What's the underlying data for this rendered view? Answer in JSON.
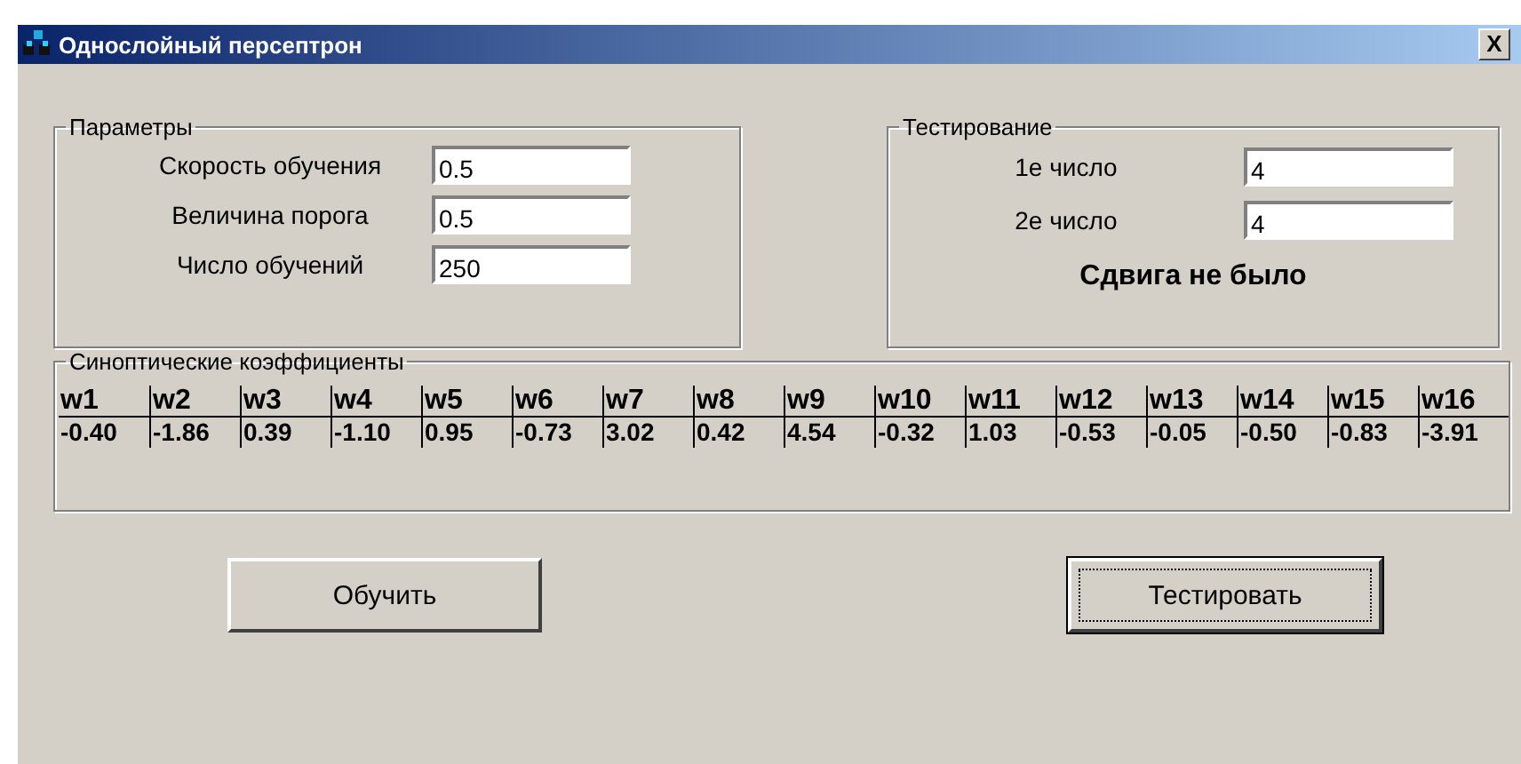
{
  "window": {
    "title": "Однослойный персептрон",
    "close": "X"
  },
  "parameters": {
    "title": "Параметры",
    "fields": [
      {
        "label": "Скорость обучения",
        "value": "0.5"
      },
      {
        "label": "Величина порога",
        "value": "0.5"
      },
      {
        "label": "Число обучений",
        "value": "250"
      }
    ]
  },
  "testing": {
    "title": "Тестирование",
    "fields": [
      {
        "label": "1е число",
        "value": "4"
      },
      {
        "label": "2е число",
        "value": "4"
      }
    ],
    "result": "Сдвига не было"
  },
  "weights": {
    "title": "Синоптические коэффициенты",
    "columns": [
      "w1",
      "w2",
      "w3",
      "w4",
      "w5",
      "w6",
      "w7",
      "w8",
      "w9",
      "w10",
      "w11",
      "w12",
      "w13",
      "w14",
      "w15",
      "w16"
    ],
    "values": [
      "-0.40",
      "-1.86",
      "0.39",
      "-1.10",
      "0.95",
      "-0.73",
      "3.02",
      "0.42",
      "4.54",
      "-0.32",
      "1.03",
      "-0.53",
      "-0.05",
      "-0.50",
      "-0.83",
      "-3.91"
    ]
  },
  "buttons": [
    {
      "label": "Обучить",
      "focused": false
    },
    {
      "label": "Тестировать",
      "focused": true
    }
  ]
}
